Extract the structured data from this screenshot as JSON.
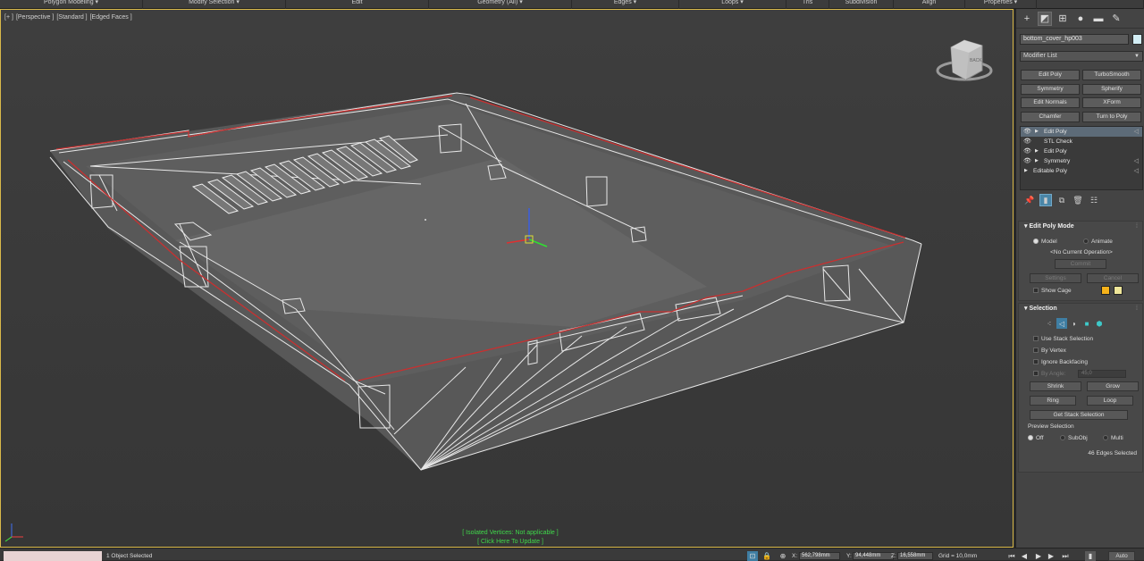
{
  "ribbon": {
    "tabs": [
      {
        "label": "Polygon Modeling ▾",
        "w": 160
      },
      {
        "label": "Modify Selection ▾",
        "w": 160
      },
      {
        "label": "Edit",
        "w": 160
      },
      {
        "label": "Geometry (All) ▾",
        "w": 160
      },
      {
        "label": "Edges ▾",
        "w": 120
      },
      {
        "label": "Loops ▾",
        "w": 120
      },
      {
        "label": "Tris",
        "w": 48
      },
      {
        "label": "Subdivision",
        "w": 72
      },
      {
        "label": "Align",
        "w": 80
      },
      {
        "label": "Properties ▾",
        "w": 80
      },
      {
        "label": "",
        "w": 120
      }
    ]
  },
  "viewport": {
    "label": [
      "[+ ]",
      "[Perspective ]",
      "[Standard ]",
      "[Edged Faces ]"
    ],
    "iso_line1": "[ Isolated Vertices: Not applicable ]",
    "iso_line2": "[ Click Here To Update ]",
    "viewcube_face": "BACK",
    "viewcube_face2": "Bottom"
  },
  "command_panel": {
    "tabs": [
      {
        "icon": "create-icon",
        "glyph": "+"
      },
      {
        "icon": "modify-icon",
        "glyph": "◩"
      },
      {
        "icon": "hierarchy-icon",
        "glyph": "⊞"
      },
      {
        "icon": "motion-icon",
        "glyph": "●"
      },
      {
        "icon": "display-icon",
        "glyph": "▬"
      },
      {
        "icon": "utilities-icon",
        "glyph": "✎"
      }
    ],
    "object_name": "bottom_cover_hp003",
    "object_color": "#d3eef5",
    "modifier_list": "Modifier List",
    "modifier_buttons": [
      "Edit Poly",
      "TurboSmooth",
      "Symmetry",
      "Spherify",
      "Edit Normals",
      "XForm",
      "Chamfer",
      "Turn to Poly"
    ],
    "stack": [
      {
        "name": "Edit Poly",
        "eye": true,
        "arrow": true,
        "tri": true,
        "selected": true
      },
      {
        "name": "STL Check",
        "eye": true,
        "arrow": false,
        "tri": false,
        "selected": false
      },
      {
        "name": "Edit Poly",
        "eye": true,
        "arrow": true,
        "tri": false,
        "selected": false
      },
      {
        "name": "Symmetry",
        "eye": true,
        "arrow": true,
        "tri": true,
        "selected": false
      },
      {
        "name": "Editable Poly",
        "eye": false,
        "arrow": true,
        "tri": true,
        "selected": false
      }
    ],
    "edit_poly_mode": {
      "title": "Edit Poly Mode",
      "model": "Model",
      "animate": "Animate",
      "current_op": "<No Current Operation>",
      "commit": "Commit",
      "settings": "Settings",
      "cancel": "Cancel",
      "show_cage": "Show Cage",
      "cage_color1": "#f5b21a",
      "cage_color2": "#f0e79a"
    },
    "selection": {
      "title": "Selection",
      "use_stack": "Use Stack Selection",
      "by_vertex": "By Vertex",
      "ignore_backfacing": "Ignore Backfacing",
      "by_angle": "By Angle:",
      "angle_value": "45,0",
      "shrink": "Shrink",
      "grow": "Grow",
      "ring": "Ring",
      "loop": "Loop",
      "get_stack": "Get Stack Selection",
      "preview_title": "Preview Selection",
      "preview_off": "Off",
      "preview_subobj": "SubObj",
      "preview_multi": "Multi",
      "status": "46 Edges Selected"
    }
  },
  "statusbar": {
    "selected": "1 Object Selected",
    "x_label": "X:",
    "x_value": "562,798mm",
    "y_label": "Y:",
    "y_value": "94,448mm",
    "z_label": "Z:",
    "z_value": "16,558mm",
    "grid": "Grid = 10,0mm",
    "auto": "Auto"
  },
  "colors": {
    "viewport_border": "#d9b94a",
    "isolated_text": "#3fd94a",
    "selected_edge": "#c83030"
  }
}
